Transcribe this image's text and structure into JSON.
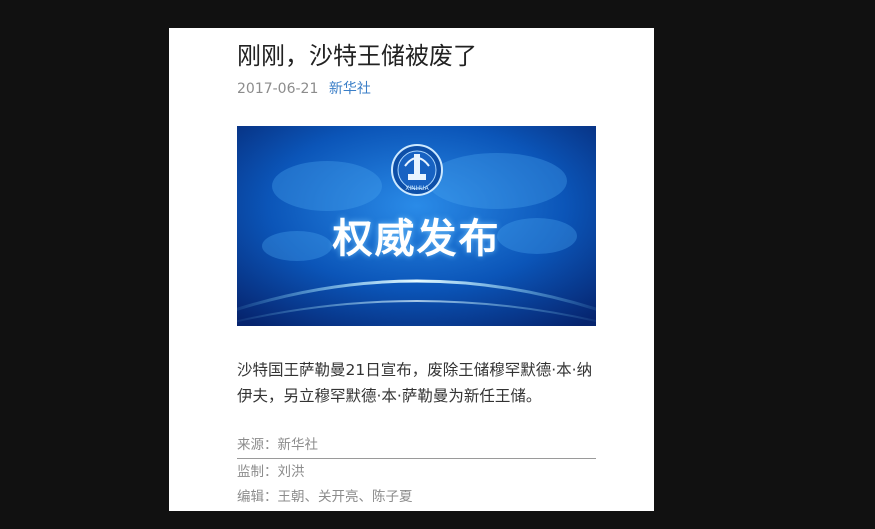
{
  "article": {
    "title": "刚刚，沙特王储被废了",
    "date": "2017-06-21",
    "source_link": "新华社",
    "banner": {
      "text": "权威发布",
      "logo": "xinhua-emblem-icon",
      "logo_text": "XINHUA"
    },
    "body": "沙特国王萨勒曼21日宣布，废除王储穆罕默德·本·纳伊夫，另立穆罕默德·本·萨勒曼为新任王储。",
    "source_line": "来源：新华社",
    "supervisor_line": "监制：刘洪",
    "editor_line": "编辑：王朝、关开亮、陈子夏"
  },
  "colors": {
    "background": "#111111",
    "page": "#ffffff",
    "link": "#3a7ec7",
    "banner_blue": "#0a4fb0"
  }
}
